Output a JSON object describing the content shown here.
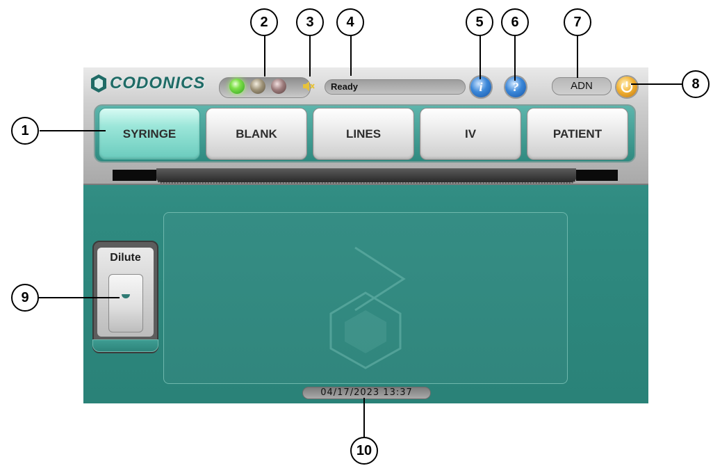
{
  "header": {
    "brand": "CODONICS",
    "status_text": "Ready",
    "user_initials": "ADN",
    "info_glyph": "i",
    "help_glyph": "?"
  },
  "indicators": [
    {
      "name": "led-green",
      "state": "on",
      "color": "#7ee04a"
    },
    {
      "name": "led-amber",
      "state": "off",
      "color": "#9e9277"
    },
    {
      "name": "led-red",
      "state": "off",
      "color": "#9c7b7b"
    },
    {
      "name": "speaker-mute-icon",
      "state": "muted",
      "color": "#e6c23a"
    }
  ],
  "tabs": [
    {
      "label": "SYRINGE",
      "selected": true
    },
    {
      "label": "BLANK",
      "selected": false
    },
    {
      "label": "LINES",
      "selected": false
    },
    {
      "label": "IV",
      "selected": false
    },
    {
      "label": "PATIENT",
      "selected": false
    }
  ],
  "dilute": {
    "label": "Dilute"
  },
  "footer": {
    "datetime": "04/17/2023 13:37"
  },
  "callouts": [
    "1",
    "2",
    "3",
    "4",
    "5",
    "6",
    "7",
    "8",
    "9",
    "10"
  ],
  "colors": {
    "teal": "#2f8a80",
    "accent": "#6acbbd",
    "info_blue": "#3b87d8",
    "power_orange": "#f2b233"
  }
}
